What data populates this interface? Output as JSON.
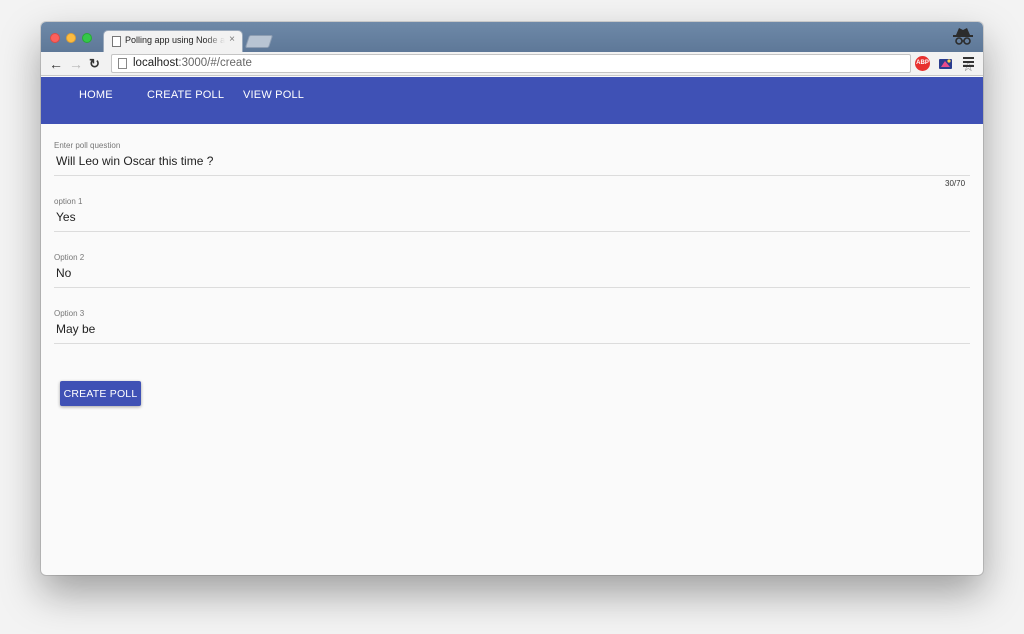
{
  "browser": {
    "tab_title": "Polling app using Node and Angular",
    "tab_close": "×",
    "url_host": "localhost",
    "url_path": ":3000/#/create",
    "abp_label": "ABP",
    "icons": [
      "back-arrow-icon",
      "forward-arrow-icon",
      "reload-icon",
      "page-icon",
      "bookmark-star-icon",
      "adblock-icon",
      "extension-icon",
      "menu-icon",
      "incognito-icon"
    ]
  },
  "nav": {
    "home": "HOME",
    "create_poll": "CREATE POLL",
    "view_poll": "VIEW POLL",
    "color": "#3f51b5"
  },
  "form": {
    "question": {
      "label": "Enter poll question",
      "value": "Will Leo win Oscar this time ?",
      "counter": "30/70"
    },
    "option1": {
      "label": "option 1",
      "value": "Yes"
    },
    "option2": {
      "label": "Option 2",
      "value": "No"
    },
    "option3": {
      "label": "Option 3",
      "value": "May be"
    },
    "submit_label": "CREATE POLL"
  }
}
